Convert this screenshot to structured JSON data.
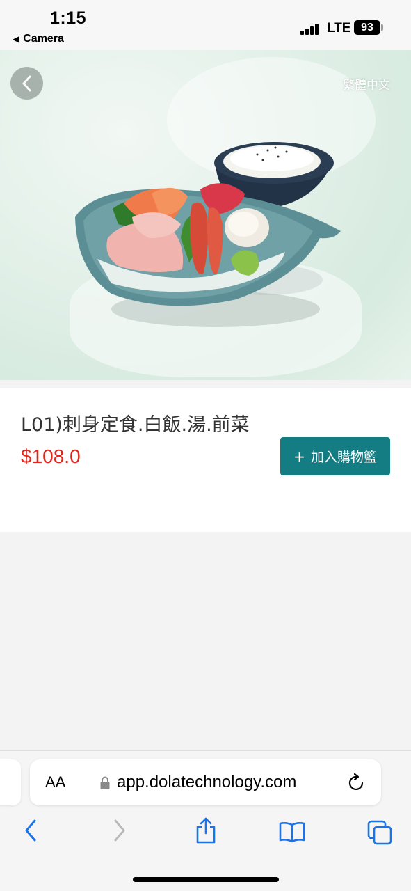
{
  "status_bar": {
    "time": "1:15",
    "back_app": "Camera",
    "network": "LTE",
    "battery": "93"
  },
  "hero": {
    "language_toggle": "繁體中文"
  },
  "product": {
    "title": "L01)刺身定食.白飯.湯.前菜",
    "price": "$108.0",
    "add_to_cart": "加入購物籃",
    "add_symbol": "+"
  },
  "browser": {
    "text_size_label": "AA",
    "url": "app.dolatechnology.com"
  },
  "colors": {
    "accent": "#147d83",
    "price": "#e1251b"
  }
}
